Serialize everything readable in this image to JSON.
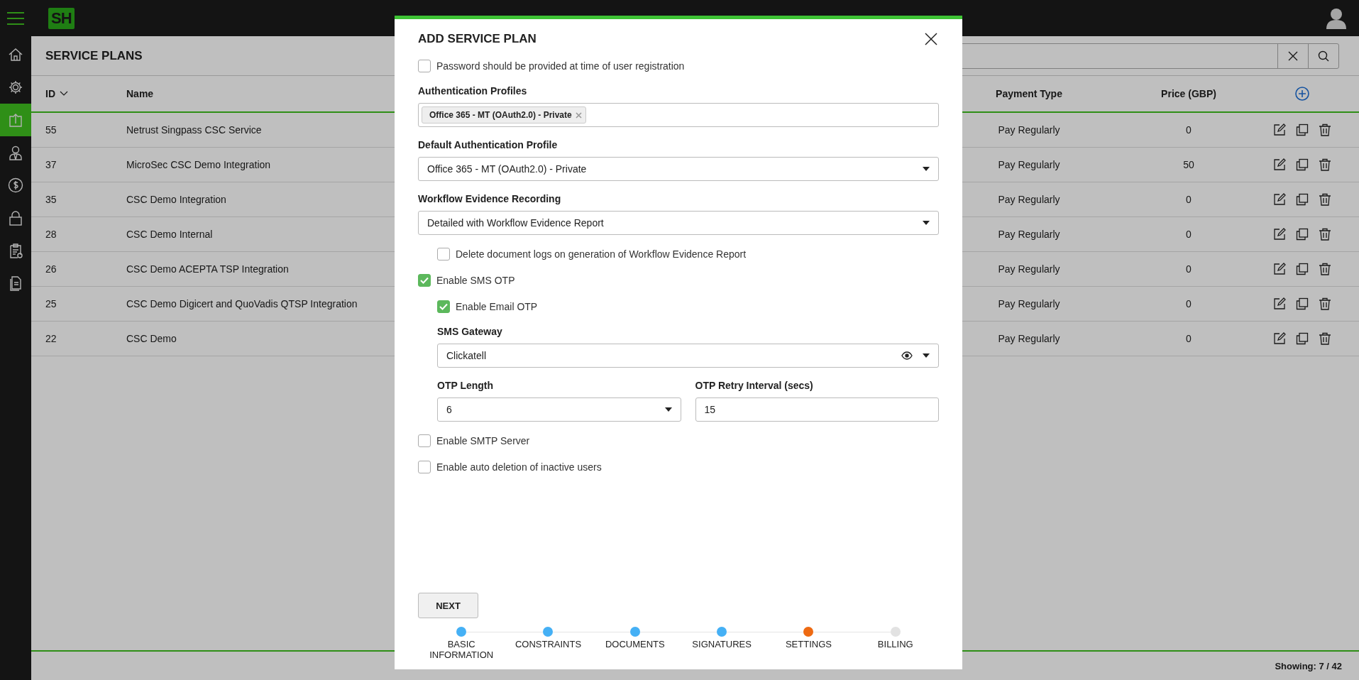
{
  "app": {
    "logo": "SH"
  },
  "sidebar": [
    {
      "kind": "home",
      "selected": false
    },
    {
      "kind": "gear",
      "selected": false
    },
    {
      "kind": "upload",
      "selected": true
    },
    {
      "kind": "person",
      "selected": false
    },
    {
      "kind": "dollar",
      "selected": false
    },
    {
      "kind": "lock",
      "selected": false
    },
    {
      "kind": "clipboard",
      "selected": false
    },
    {
      "kind": "document",
      "selected": false
    }
  ],
  "page": {
    "title": "SERVICE PLANS"
  },
  "table": {
    "columns": [
      {
        "label": "ID",
        "sorted": true
      },
      {
        "label": "Name",
        "sorted": false
      },
      {
        "label": "Payment Type",
        "sorted": false
      },
      {
        "label": "Price (GBP)",
        "sorted": false
      }
    ],
    "rows": [
      {
        "id": "55",
        "name": "Netrust Singpass CSC Service",
        "payment": "Pay Regularly",
        "price": "0"
      },
      {
        "id": "37",
        "name": "MicroSec CSC Demo Integration",
        "payment": "Pay Regularly",
        "price": "50"
      },
      {
        "id": "35",
        "name": "CSC Demo Integration",
        "payment": "Pay Regularly",
        "price": "0"
      },
      {
        "id": "28",
        "name": "CSC Demo Internal",
        "payment": "Pay Regularly",
        "price": "0"
      },
      {
        "id": "26",
        "name": "CSC Demo ACEPTA TSP Integration",
        "payment": "Pay Regularly",
        "price": "0"
      },
      {
        "id": "25",
        "name": "CSC Demo Digicert and QuoVadis QTSP Integration",
        "payment": "Pay Regularly",
        "price": "0"
      },
      {
        "id": "22",
        "name": "CSC Demo",
        "payment": "Pay Regularly",
        "price": "0"
      }
    ]
  },
  "status_bar": {
    "text": "Showing: 7 / 42"
  },
  "modal": {
    "title": "ADD SERVICE PLAN",
    "fields": [
      {
        "kind": "checkbox",
        "label": "Password should be provided at time of user registration",
        "checked": false
      },
      {
        "kind": "tags",
        "label": "Authentication Profiles",
        "tags": [
          "Office 365 - MT (OAuth2.0) - Private"
        ]
      },
      {
        "kind": "select",
        "label": "Default Authentication Profile",
        "value": "Office 365 - MT (OAuth2.0) - Private"
      },
      {
        "kind": "select",
        "label": "Workflow Evidence Recording",
        "value": "Detailed with Workflow Evidence Report",
        "children": [
          {
            "kind": "checkbox",
            "label": "Delete document logs on generation of Workflow Evidence Report",
            "checked": false
          }
        ]
      },
      {
        "kind": "checkbox",
        "label": "Enable SMS OTP",
        "checked": true,
        "children": [
          {
            "kind": "checkbox",
            "label": "Enable Email OTP",
            "checked": true
          },
          {
            "kind": "select",
            "label": "SMS Gateway",
            "value": "Clickatell",
            "eye": true
          },
          {
            "kind": "pair",
            "items": [
              {
                "kind": "select",
                "label": "OTP Length",
                "value": "6"
              },
              {
                "kind": "input",
                "label": "OTP Retry Interval (secs)",
                "value": "15"
              }
            ]
          }
        ]
      },
      {
        "kind": "checkbox",
        "label": "Enable SMTP Server",
        "checked": false
      },
      {
        "kind": "checkbox",
        "label": "Enable auto deletion of inactive users",
        "checked": false
      }
    ],
    "button": "NEXT",
    "steps": [
      {
        "label": "BASIC INFORMATION",
        "selected": false
      },
      {
        "label": "CONSTRAINTS",
        "selected": false
      },
      {
        "label": "DOCUMENTS",
        "selected": false
      },
      {
        "label": "SIGNATURES",
        "selected": false
      },
      {
        "label": "SETTINGS",
        "selected": true
      },
      {
        "label": "BILLING",
        "selected": false
      }
    ]
  }
}
